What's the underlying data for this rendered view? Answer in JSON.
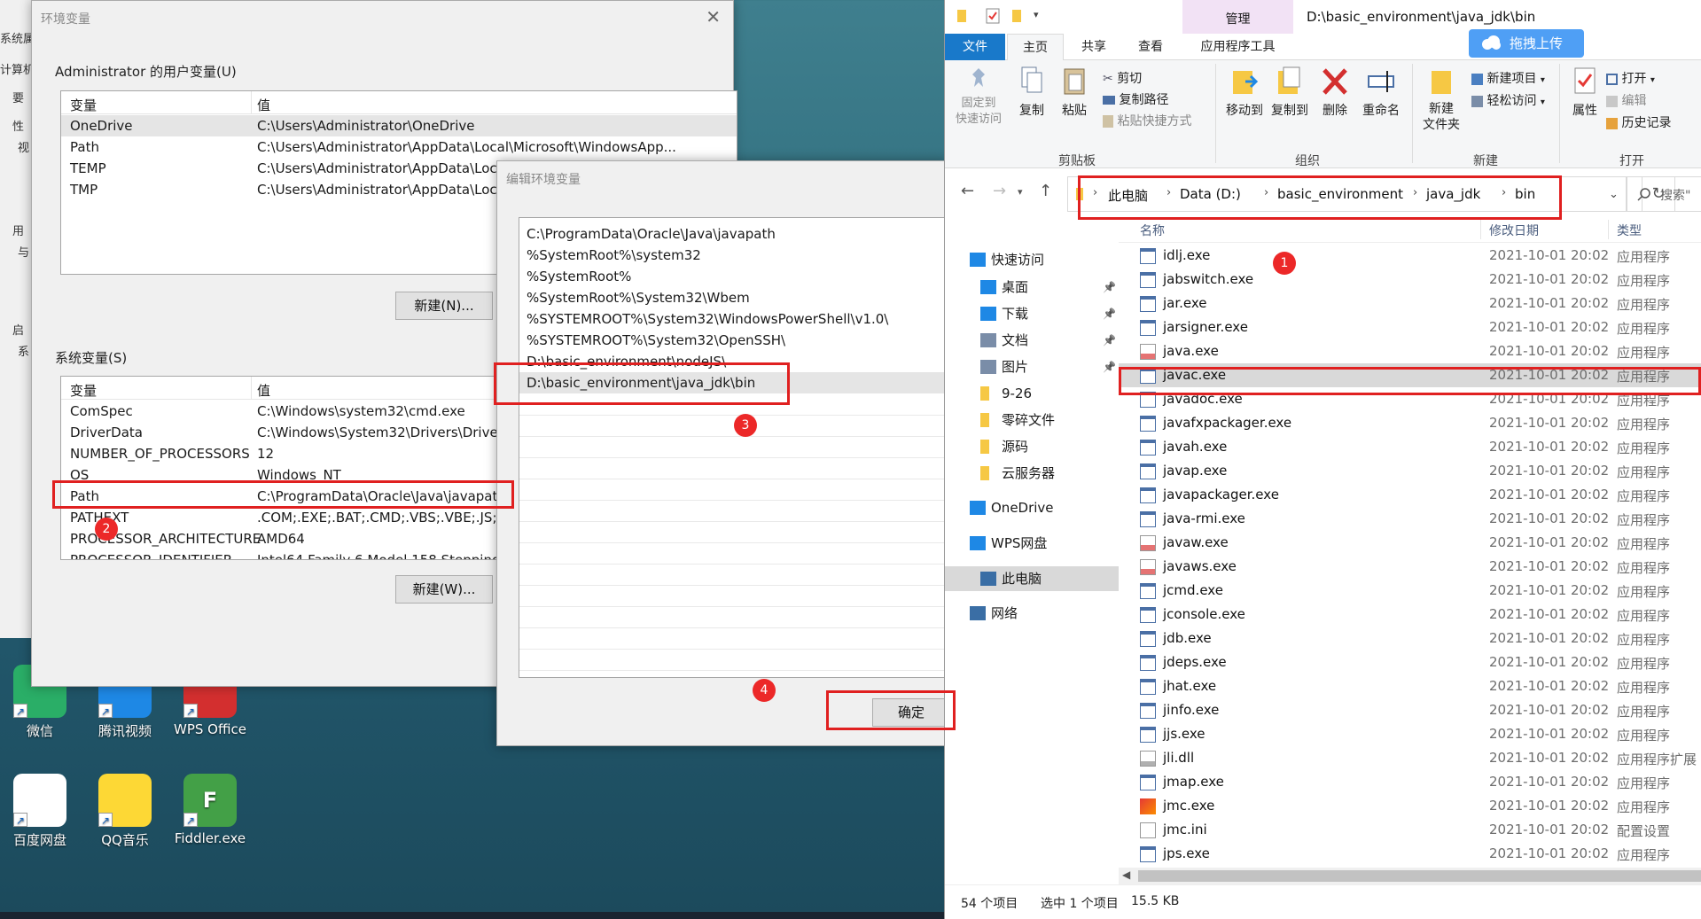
{
  "bg_window": {
    "fragments": [
      "系统属",
      "计算机",
      "要",
      "性",
      "视",
      "用",
      "与",
      "启",
      "系"
    ]
  },
  "env_dialog": {
    "title": "环境变量",
    "user_section_label": "Administrator 的用户变量(U)",
    "col_variable": "变量",
    "col_value": "值",
    "user_vars": [
      {
        "name": "OneDrive",
        "value": "C:\\Users\\Administrator\\OneDrive"
      },
      {
        "name": "Path",
        "value": "C:\\Users\\Administrator\\AppData\\Local\\Microsoft\\WindowsApp..."
      },
      {
        "name": "TEMP",
        "value": "C:\\Users\\Administrator\\AppData\\Loc"
      },
      {
        "name": "TMP",
        "value": "C:\\Users\\Administrator\\AppData\\Loc"
      }
    ],
    "user_new_button": "新建(N)...",
    "system_section_label": "系统变量(S)",
    "system_vars": [
      {
        "name": "ComSpec",
        "value": "C:\\Windows\\system32\\cmd.exe"
      },
      {
        "name": "DriverData",
        "value": "C:\\Windows\\System32\\Drivers\\Drive"
      },
      {
        "name": "NUMBER_OF_PROCESSORS",
        "value": "12"
      },
      {
        "name": "OS",
        "value": "Windows_NT"
      },
      {
        "name": "Path",
        "value": "C:\\ProgramData\\Oracle\\Java\\javapath"
      },
      {
        "name": "PATHEXT",
        "value": ".COM;.EXE;.BAT;.CMD;.VBS;.VBE;.JS;.JS"
      },
      {
        "name": "PROCESSOR_ARCHITECTURE",
        "value": "AMD64"
      },
      {
        "name": "PROCESSOR_IDENTIFIER",
        "value": "Intel64 Family 6 Model 158 Stepping"
      }
    ],
    "system_new_button": "新建(W)..."
  },
  "edit_dialog": {
    "title": "编辑环境变量",
    "entries": [
      "C:\\ProgramData\\Oracle\\Java\\javapath",
      "%SystemRoot%\\system32",
      "%SystemRoot%",
      "%SystemRoot%\\System32\\Wbem",
      "%SYSTEMROOT%\\System32\\WindowsPowerShell\\v1.0\\",
      "%SYSTEMROOT%\\System32\\OpenSSH\\",
      "D:\\basic_environment\\nodeJS\\",
      "D:\\basic_environment\\java_jdk\\bin"
    ],
    "ok_button": "确定"
  },
  "annotations": {
    "badges": [
      "1",
      "2",
      "3",
      "4"
    ],
    "color": "#e02020"
  },
  "desktop": {
    "icons": [
      {
        "label": "微信",
        "color": "#2aae67"
      },
      {
        "label": "腾讯视频",
        "color": "#1e88e5"
      },
      {
        "label": "WPS Office",
        "color": "#d32f2f"
      },
      {
        "label": "百度网盘",
        "color": "#ffffff"
      },
      {
        "label": "QQ音乐",
        "color": "#fdd835"
      },
      {
        "label": "Fiddler.exe",
        "color": "#43a047",
        "glyph": "F"
      }
    ]
  },
  "explorer": {
    "title_path": "D:\\basic_environment\\java_jdk\\bin",
    "manage_tab": "管理",
    "upload_button": "拖拽上传",
    "tabs": [
      "文件",
      "主页",
      "共享",
      "查看",
      "应用程序工具"
    ],
    "ribbon": {
      "pin_quick_access": "固定到\n快速访问",
      "copy": "复制",
      "paste": "粘贴",
      "cut": "剪切",
      "copy_path": "复制路径",
      "paste_shortcut": "粘贴快捷方式",
      "clipboard_group": "剪贴板",
      "move_to": "移动到",
      "copy_to": "复制到",
      "delete": "删除",
      "rename": "重命名",
      "organize_group": "组织",
      "new_folder": "新建\n文件夹",
      "new_item": "新建项目",
      "easy_access": "轻松访问",
      "new_group": "新建",
      "properties": "属性",
      "open": "打开",
      "edit": "编辑",
      "history": "历史记录",
      "open_group": "打开"
    },
    "breadcrumbs": [
      "此电脑",
      "Data (D:)",
      "basic_environment",
      "java_jdk",
      "bin"
    ],
    "search_placeholder": "搜索\"",
    "nav_items": [
      {
        "label": "快速访问",
        "icon": "star-icon",
        "pinned": false
      },
      {
        "label": "桌面",
        "icon": "desktop-icon",
        "pinned": true
      },
      {
        "label": "下载",
        "icon": "download-icon",
        "pinned": true
      },
      {
        "label": "文档",
        "icon": "document-icon",
        "pinned": true
      },
      {
        "label": "图片",
        "icon": "pictures-icon",
        "pinned": true
      },
      {
        "label": "9-26",
        "icon": "folder-icon",
        "pinned": false
      },
      {
        "label": "零碎文件",
        "icon": "folder-icon",
        "pinned": false
      },
      {
        "label": "源码",
        "icon": "folder-icon",
        "pinned": false
      },
      {
        "label": "云服务器",
        "icon": "folder-icon",
        "pinned": false
      },
      {
        "label": "OneDrive",
        "icon": "cloud-icon",
        "pinned": false
      },
      {
        "label": "WPS网盘",
        "icon": "cloud-icon",
        "pinned": false
      },
      {
        "label": "此电脑",
        "icon": "computer-icon",
        "pinned": false
      },
      {
        "label": "网络",
        "icon": "network-icon",
        "pinned": false
      }
    ],
    "columns": {
      "name": "名称",
      "date": "修改日期",
      "type": "类型"
    },
    "files": [
      {
        "name": "idlj.exe",
        "date": "2021-10-01 20:02",
        "type": "应用程序",
        "icon": "exe-icon"
      },
      {
        "name": "jabswitch.exe",
        "date": "2021-10-01 20:02",
        "type": "应用程序",
        "icon": "exe-icon"
      },
      {
        "name": "jar.exe",
        "date": "2021-10-01 20:02",
        "type": "应用程序",
        "icon": "exe-icon"
      },
      {
        "name": "jarsigner.exe",
        "date": "2021-10-01 20:02",
        "type": "应用程序",
        "icon": "exe-icon"
      },
      {
        "name": "java.exe",
        "date": "2021-10-01 20:02",
        "type": "应用程序",
        "icon": "java-icon"
      },
      {
        "name": "javac.exe",
        "date": "2021-10-01 20:02",
        "type": "应用程序",
        "icon": "exe-icon"
      },
      {
        "name": "javadoc.exe",
        "date": "2021-10-01 20:02",
        "type": "应用程序",
        "icon": "exe-icon"
      },
      {
        "name": "javafxpackager.exe",
        "date": "2021-10-01 20:02",
        "type": "应用程序",
        "icon": "exe-icon"
      },
      {
        "name": "javah.exe",
        "date": "2021-10-01 20:02",
        "type": "应用程序",
        "icon": "exe-icon"
      },
      {
        "name": "javap.exe",
        "date": "2021-10-01 20:02",
        "type": "应用程序",
        "icon": "exe-icon"
      },
      {
        "name": "javapackager.exe",
        "date": "2021-10-01 20:02",
        "type": "应用程序",
        "icon": "exe-icon"
      },
      {
        "name": "java-rmi.exe",
        "date": "2021-10-01 20:02",
        "type": "应用程序",
        "icon": "exe-icon"
      },
      {
        "name": "javaw.exe",
        "date": "2021-10-01 20:02",
        "type": "应用程序",
        "icon": "java-icon"
      },
      {
        "name": "javaws.exe",
        "date": "2021-10-01 20:02",
        "type": "应用程序",
        "icon": "java-icon"
      },
      {
        "name": "jcmd.exe",
        "date": "2021-10-01 20:02",
        "type": "应用程序",
        "icon": "exe-icon"
      },
      {
        "name": "jconsole.exe",
        "date": "2021-10-01 20:02",
        "type": "应用程序",
        "icon": "exe-icon"
      },
      {
        "name": "jdb.exe",
        "date": "2021-10-01 20:02",
        "type": "应用程序",
        "icon": "exe-icon"
      },
      {
        "name": "jdeps.exe",
        "date": "2021-10-01 20:02",
        "type": "应用程序",
        "icon": "exe-icon"
      },
      {
        "name": "jhat.exe",
        "date": "2021-10-01 20:02",
        "type": "应用程序",
        "icon": "exe-icon"
      },
      {
        "name": "jinfo.exe",
        "date": "2021-10-01 20:02",
        "type": "应用程序",
        "icon": "exe-icon"
      },
      {
        "name": "jjs.exe",
        "date": "2021-10-01 20:02",
        "type": "应用程序",
        "icon": "exe-icon"
      },
      {
        "name": "jli.dll",
        "date": "2021-10-01 20:02",
        "type": "应用程序扩展",
        "icon": "dll-icon"
      },
      {
        "name": "jmap.exe",
        "date": "2021-10-01 20:02",
        "type": "应用程序",
        "icon": "exe-icon"
      },
      {
        "name": "jmc.exe",
        "date": "2021-10-01 20:02",
        "type": "应用程序",
        "icon": "jmc-icon"
      },
      {
        "name": "jmc.ini",
        "date": "2021-10-01 20:02",
        "type": "配置设置",
        "icon": "ini-icon"
      },
      {
        "name": "jps.exe",
        "date": "2021-10-01 20:02",
        "type": "应用程序",
        "icon": "exe-icon"
      }
    ],
    "selected_file_index": 5,
    "status": {
      "count": "54 个项目",
      "selected": "选中 1 个项目",
      "size": "15.5 KB"
    }
  }
}
